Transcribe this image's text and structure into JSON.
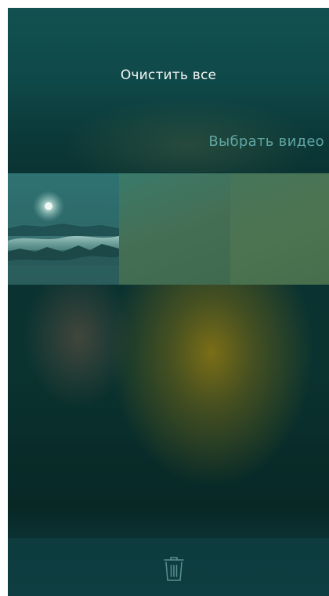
{
  "header": {
    "clear_all_label": "Очистить все",
    "choose_video_label": "Выбрать видео"
  },
  "colors": {
    "background_top": "#114c4c",
    "background_mid": "#0a3231",
    "glow_accent": "#8e7812",
    "choose_video_text": "#5fa6a3",
    "clear_all_text": "#f2f5f4",
    "bottom_bar": "#0d3b3e"
  },
  "thumbnails": [
    {
      "icon": "landscape-sun-clouds"
    },
    {
      "icon": "green-blur"
    },
    {
      "icon": "green-blur"
    }
  ],
  "toolbar": {
    "delete_icon": "trash-icon"
  }
}
